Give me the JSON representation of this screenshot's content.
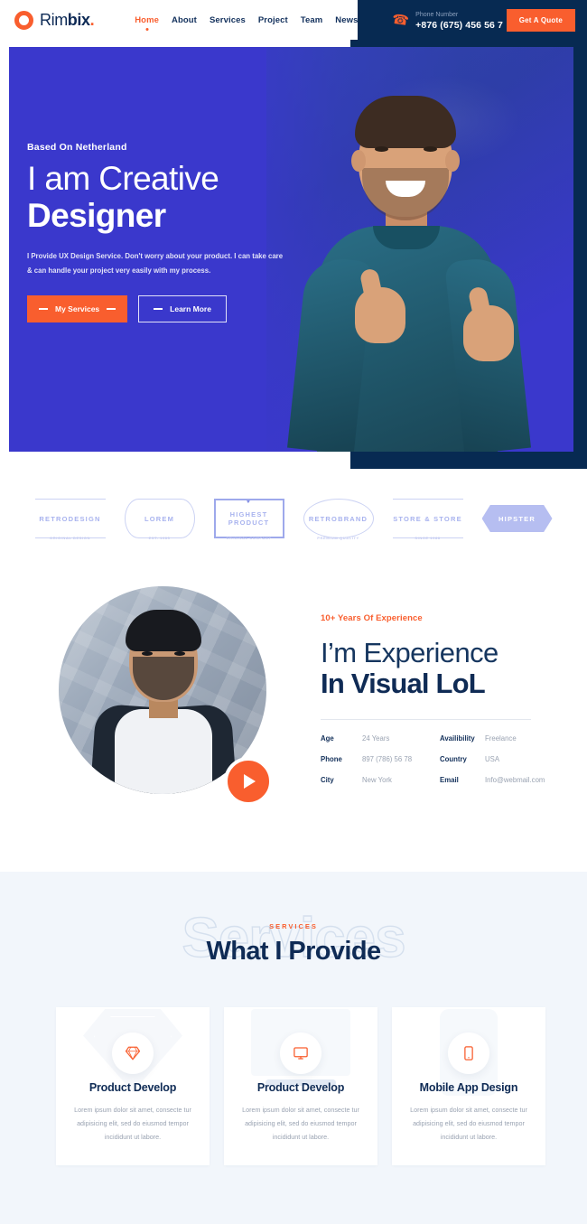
{
  "header": {
    "logo": {
      "part1": "Rim",
      "part2": "bix",
      "dot": ".",
      "icon": "ring-logo-icon"
    },
    "nav": [
      {
        "label": "Home",
        "active": true
      },
      {
        "label": "About",
        "active": false
      },
      {
        "label": "Services",
        "active": false
      },
      {
        "label": "Project",
        "active": false
      },
      {
        "label": "Team",
        "active": false
      },
      {
        "label": "News",
        "active": false
      }
    ],
    "phone_label": "Phone Number",
    "phone_number": "+876 (675) 456 56 7",
    "phone_icon": "phone-icon",
    "quote_button": "Get A Quote"
  },
  "hero": {
    "kicker": "Based On Netherland",
    "title_line1": "I am Creative",
    "title_line2": "Designer",
    "description": "I Provide UX Design Service. Don't worry about your product. I can take care & can handle your project very easily with my process.",
    "primary_button": "My Services",
    "secondary_button": "Learn More",
    "bg_color": "#3a38cc",
    "navy_color": "#072a52"
  },
  "brands": [
    {
      "label": "RETRODESIGN",
      "sub": "ORIGINAL DESIGN"
    },
    {
      "label": "LOREM",
      "sub": "EST. 1985"
    },
    {
      "label": "HIGHEST PRODUCT",
      "sub": "ORIGINAL COMPANY"
    },
    {
      "label": "RETROBRAND",
      "sub": "PREMIUM QUALITY"
    },
    {
      "label": "STORE & STORE",
      "sub": "SINCE 1988"
    },
    {
      "label": "HIPSTER",
      "sub": ""
    }
  ],
  "experience": {
    "kicker": "10+ Years Of Experience",
    "title_line1": "I’m Experience",
    "title_line2": "In Visual LoL",
    "play_button_icon": "play-icon",
    "info": [
      {
        "key": "Age",
        "value": "24 Years"
      },
      {
        "key": "Availibility",
        "value": "Freelance"
      },
      {
        "key": "Phone",
        "value": "897 (786) 56 78"
      },
      {
        "key": "Country",
        "value": "USA"
      },
      {
        "key": "City",
        "value": "New York"
      },
      {
        "key": "Email",
        "value": "Info@webmail.com"
      }
    ]
  },
  "services": {
    "kicker": "SERVICES",
    "title": "What I Provide",
    "watermark": "Services",
    "cards": [
      {
        "icon": "gem-icon",
        "title": "Product Develop",
        "description": "Lorem ipsum dolor sit amet, consecte tur adipisicing elit, sed do eiusmod tempor incididunt ut labore."
      },
      {
        "icon": "monitor-icon",
        "title": "Product Develop",
        "description": "Lorem ipsum dolor sit amet, consecte tur adipisicing elit, sed do eiusmod tempor incididunt ut labore."
      },
      {
        "icon": "mobile-icon",
        "title": "Mobile App Design",
        "description": "Lorem ipsum dolor sit amet, consecte tur adipisicing elit, sed do eiusmod tempor incididunt ut labore."
      }
    ]
  },
  "colors": {
    "accent": "#f95e2e",
    "navy": "#072a52",
    "hero_blue": "#3a38cc",
    "services_bg": "#f2f6fb",
    "title_navy": "#0f2b55"
  }
}
